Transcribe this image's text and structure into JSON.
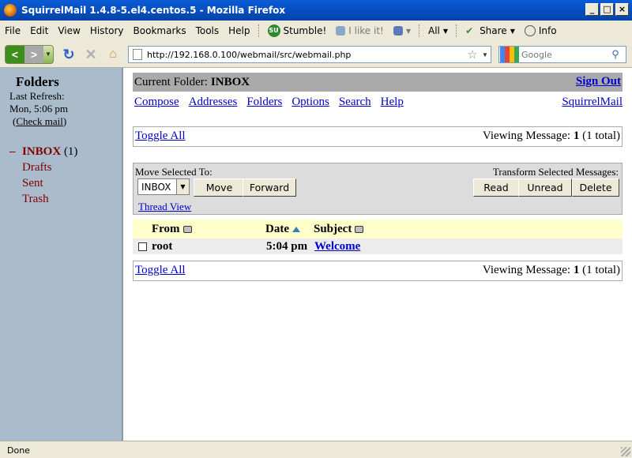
{
  "window": {
    "title": "SquirrelMail 1.4.8-5.el4.centos.5 - Mozilla Firefox"
  },
  "menu": {
    "items": [
      "File",
      "Edit",
      "View",
      "History",
      "Bookmarks",
      "Tools",
      "Help"
    ],
    "stumble": "Stumble!",
    "ilike": "I like it!",
    "all": "All",
    "share": "Share",
    "info": "Info"
  },
  "nav": {
    "url": "http://192.168.0.100/webmail/src/webmail.php",
    "search_placeholder": "Google"
  },
  "left": {
    "title": "Folders",
    "last_refresh_label": "Last Refresh:",
    "last_refresh_time": "Mon, 5:06 pm",
    "check_mail": "Check mail",
    "inbox": "INBOX",
    "inbox_count": "(1)",
    "folders": [
      "Drafts",
      "Sent",
      "Trash"
    ]
  },
  "header": {
    "current_folder_label": "Current Folder:",
    "current_folder": "INBOX",
    "sign_out": "Sign Out"
  },
  "topnav": {
    "links": [
      "Compose",
      "Addresses",
      "Folders",
      "Options",
      "Search",
      "Help"
    ],
    "brand": "SquirrelMail"
  },
  "listing": {
    "toggle_all": "Toggle All",
    "viewing_label": "Viewing Message:",
    "viewing_count": "1",
    "viewing_total": "(1 total)"
  },
  "controls": {
    "move_label": "Move Selected To:",
    "move_target": "INBOX",
    "move_button": "Move",
    "forward_button": "Forward",
    "transform_label": "Transform Selected Messages:",
    "read_button": "Read",
    "unread_button": "Unread",
    "delete_button": "Delete",
    "thread_view": "Thread View"
  },
  "table": {
    "columns": {
      "from": "From",
      "date": "Date",
      "subject": "Subject"
    },
    "rows": [
      {
        "from": "root",
        "date": "5:04 pm",
        "subject": "Welcome"
      }
    ]
  },
  "status": {
    "text": "Done"
  }
}
